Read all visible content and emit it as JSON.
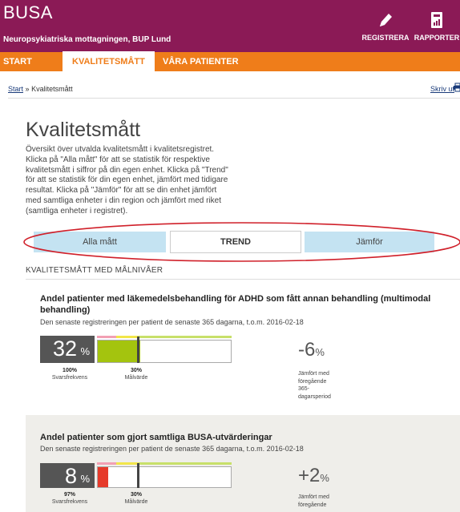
{
  "header": {
    "brand": "BUSA",
    "unit_name": "Neuropsykiatriska mottagningen, BUP Lund",
    "register_label": "REGISTRERA",
    "reports_label": "RAPPORTER"
  },
  "nav": {
    "items": [
      {
        "label": "START"
      },
      {
        "label": "KVALITETSMÅTT"
      },
      {
        "label": "VÅRA PATIENTER"
      }
    ]
  },
  "breadcrumb": {
    "home": "Start",
    "separator": "»",
    "current": "Kvalitetsmått",
    "print_label": "Skriv ut"
  },
  "page": {
    "title": "Kvalitetsmått",
    "intro_lines": [
      "Översikt över utvalda kvalitetsmått i kvalitetsregistret.",
      "Klicka på \"Alla mått\" för att se statistik för respektive",
      "kvalitetsmått i siffror på din egen enhet. Klicka på \"Trend\"",
      "för att se statistik för din egen enhet, jämfört med tidigare",
      "resultat. Klicka på \"Jämför\" för att se din enhet jämfört",
      "med samtliga enheter i din region och jämfört med riket",
      "(samtliga enheter i registret)."
    ]
  },
  "tabs": [
    {
      "label": "Alla mått",
      "active": false
    },
    {
      "label": "TREND",
      "active": true
    },
    {
      "label": "Jämför",
      "active": false
    }
  ],
  "section_label": "KVALITETSMÅTT MED MÅLNIVÅER",
  "measures": [
    {
      "title_lines": [
        "Andel patienter med läkemedelsbehandling för ADHD som fått annan behandling (multimodal",
        "behandling)"
      ],
      "subtitle": "Den senaste registreringen per patient de senaste 365 dagarna, t.o.m. 2016-02-18",
      "value": "32",
      "value_unit": "%",
      "fill_fraction": 0.32,
      "target_fraction": 0.3,
      "fill_color": "#a4c40e",
      "response_rate": "100%",
      "response_label": "Svarsfrekvens",
      "target_value": "30%",
      "target_label": "Målvärde",
      "delta": "-6",
      "delta_unit": "%",
      "delta_note_lines": [
        "Jämfört med",
        "föregående",
        "365-",
        "dagarsperiod"
      ]
    },
    {
      "title_lines": [
        "Andel patienter som gjort samtliga BUSA-utvärderingar"
      ],
      "subtitle": "Den senaste registreringen per patient de senaste 365 dagarna, t.o.m. 2016-02-18",
      "value": "8",
      "value_unit": "%",
      "fill_fraction": 0.08,
      "target_fraction": 0.3,
      "fill_color": "#e63a2a",
      "response_rate": "97%",
      "response_label": "Svarsfrekvens",
      "target_value": "30%",
      "target_label": "Målvärde",
      "delta": "+2",
      "delta_unit": "%",
      "delta_note_lines": [
        "Jämfört med",
        "föregående"
      ]
    }
  ],
  "colors": {
    "header": "#8b1a56",
    "nav": "#ef7d1a",
    "tab_inactive": "#c4e3f2",
    "strip_pink": "#f2a0b4",
    "strip_yellow": "#f2e64a",
    "strip_green": "#c8e06a",
    "annotation": "#d0202a"
  }
}
